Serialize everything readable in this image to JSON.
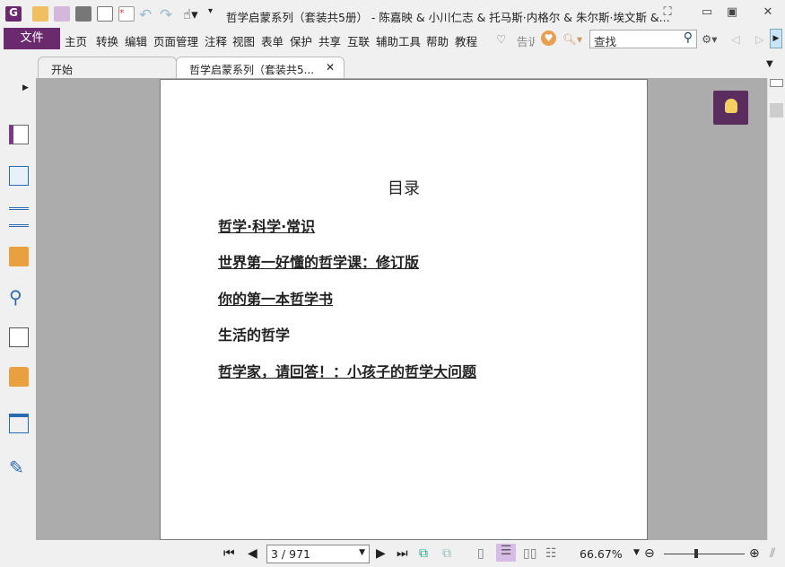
{
  "window": {
    "title": "哲学启蒙系列（套装共5册） - 陈嘉映 & 小川仁志 & 托马斯·内格尔 & 朱尔斯·埃文斯 &..."
  },
  "menu": {
    "file": "文件",
    "items": [
      "主页",
      "转换",
      "编辑",
      "页面管理",
      "注释",
      "视图",
      "表单",
      "保护",
      "共享",
      "互联",
      "辅助工具",
      "帮助",
      "教程"
    ],
    "tell_me": "告诉",
    "search_placeholder": "查找"
  },
  "tabs": [
    {
      "label": "开始"
    },
    {
      "label": "哲学启蒙系列（套装共5..."
    }
  ],
  "document": {
    "toc_title": "目录",
    "toc_items": [
      "哲学·科学·常识",
      "世界第一好懂的哲学课：修订版",
      "你的第一本哲学书",
      "生活的哲学",
      "哲学家，请回答！：小孩子的哲学大问题"
    ]
  },
  "status": {
    "page": "3 / 971",
    "zoom": "66.67%",
    "zoom_slider_fraction": 0.4
  },
  "colors": {
    "accent": "#6b2a6e",
    "canvas": "#acacac"
  }
}
